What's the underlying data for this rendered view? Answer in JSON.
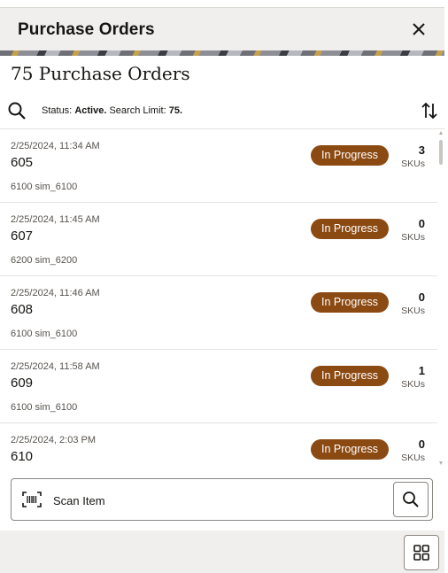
{
  "header": {
    "title": "Purchase Orders"
  },
  "page": {
    "title": "75 Purchase Orders"
  },
  "filter": {
    "status_prefix": "Status:",
    "status_value": "Active.",
    "limit_prefix": "Search Limit:",
    "limit_value": "75."
  },
  "orders": [
    {
      "date": "2/25/2024, 11:34 AM",
      "id": "605",
      "location": "6100 sim_6100",
      "status": "In Progress",
      "sku_count": "3",
      "sku_label": "SKUs"
    },
    {
      "date": "2/25/2024, 11:45 AM",
      "id": "607",
      "location": "6200 sim_6200",
      "status": "In Progress",
      "sku_count": "0",
      "sku_label": "SKUs"
    },
    {
      "date": "2/25/2024, 11:46 AM",
      "id": "608",
      "location": "6100 sim_6100",
      "status": "In Progress",
      "sku_count": "0",
      "sku_label": "SKUs"
    },
    {
      "date": "2/25/2024, 11:58 AM",
      "id": "609",
      "location": "6100 sim_6100",
      "status": "In Progress",
      "sku_count": "1",
      "sku_label": "SKUs"
    },
    {
      "date": "2/25/2024, 2:03 PM",
      "id": "610",
      "location": "",
      "status": "In Progress",
      "sku_count": "0",
      "sku_label": "SKUs"
    }
  ],
  "scan": {
    "placeholder": "Scan Item",
    "value": ""
  },
  "icons": {
    "close": "close-icon",
    "search": "search-icon",
    "sort": "sort-arrows-icon",
    "barcode": "barcode-icon",
    "grid": "grid-icon"
  },
  "colors": {
    "badge": "#8c4a13",
    "header_bg": "#f1efed"
  }
}
